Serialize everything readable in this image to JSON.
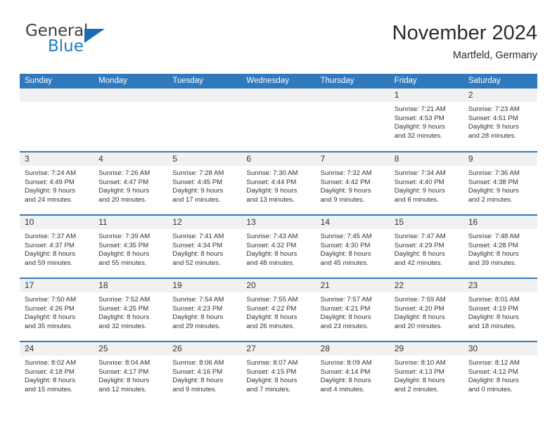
{
  "brand": {
    "name_part1": "General",
    "name_part2": "Blue"
  },
  "header": {
    "title": "November 2024",
    "subtitle": "Martfeld, Germany"
  },
  "weekday_headers": [
    "Sunday",
    "Monday",
    "Tuesday",
    "Wednesday",
    "Thursday",
    "Friday",
    "Saturday"
  ],
  "colors": {
    "header_blue": "#3079bd",
    "daynum_band": "#f1f1f1",
    "brand_blue": "#1d7cc4",
    "text": "#333333"
  },
  "weeks": [
    [
      {
        "day": "",
        "lines": []
      },
      {
        "day": "",
        "lines": []
      },
      {
        "day": "",
        "lines": []
      },
      {
        "day": "",
        "lines": []
      },
      {
        "day": "",
        "lines": []
      },
      {
        "day": "1",
        "lines": [
          "Sunrise: 7:21 AM",
          "Sunset: 4:53 PM",
          "Daylight: 9 hours",
          "and 32 minutes."
        ]
      },
      {
        "day": "2",
        "lines": [
          "Sunrise: 7:23 AM",
          "Sunset: 4:51 PM",
          "Daylight: 9 hours",
          "and 28 minutes."
        ]
      }
    ],
    [
      {
        "day": "3",
        "lines": [
          "Sunrise: 7:24 AM",
          "Sunset: 4:49 PM",
          "Daylight: 9 hours",
          "and 24 minutes."
        ]
      },
      {
        "day": "4",
        "lines": [
          "Sunrise: 7:26 AM",
          "Sunset: 4:47 PM",
          "Daylight: 9 hours",
          "and 20 minutes."
        ]
      },
      {
        "day": "5",
        "lines": [
          "Sunrise: 7:28 AM",
          "Sunset: 4:45 PM",
          "Daylight: 9 hours",
          "and 17 minutes."
        ]
      },
      {
        "day": "6",
        "lines": [
          "Sunrise: 7:30 AM",
          "Sunset: 4:44 PM",
          "Daylight: 9 hours",
          "and 13 minutes."
        ]
      },
      {
        "day": "7",
        "lines": [
          "Sunrise: 7:32 AM",
          "Sunset: 4:42 PM",
          "Daylight: 9 hours",
          "and 9 minutes."
        ]
      },
      {
        "day": "8",
        "lines": [
          "Sunrise: 7:34 AM",
          "Sunset: 4:40 PM",
          "Daylight: 9 hours",
          "and 6 minutes."
        ]
      },
      {
        "day": "9",
        "lines": [
          "Sunrise: 7:36 AM",
          "Sunset: 4:38 PM",
          "Daylight: 9 hours",
          "and 2 minutes."
        ]
      }
    ],
    [
      {
        "day": "10",
        "lines": [
          "Sunrise: 7:37 AM",
          "Sunset: 4:37 PM",
          "Daylight: 8 hours",
          "and 59 minutes."
        ]
      },
      {
        "day": "11",
        "lines": [
          "Sunrise: 7:39 AM",
          "Sunset: 4:35 PM",
          "Daylight: 8 hours",
          "and 55 minutes."
        ]
      },
      {
        "day": "12",
        "lines": [
          "Sunrise: 7:41 AM",
          "Sunset: 4:34 PM",
          "Daylight: 8 hours",
          "and 52 minutes."
        ]
      },
      {
        "day": "13",
        "lines": [
          "Sunrise: 7:43 AM",
          "Sunset: 4:32 PM",
          "Daylight: 8 hours",
          "and 48 minutes."
        ]
      },
      {
        "day": "14",
        "lines": [
          "Sunrise: 7:45 AM",
          "Sunset: 4:30 PM",
          "Daylight: 8 hours",
          "and 45 minutes."
        ]
      },
      {
        "day": "15",
        "lines": [
          "Sunrise: 7:47 AM",
          "Sunset: 4:29 PM",
          "Daylight: 8 hours",
          "and 42 minutes."
        ]
      },
      {
        "day": "16",
        "lines": [
          "Sunrise: 7:48 AM",
          "Sunset: 4:28 PM",
          "Daylight: 8 hours",
          "and 39 minutes."
        ]
      }
    ],
    [
      {
        "day": "17",
        "lines": [
          "Sunrise: 7:50 AM",
          "Sunset: 4:26 PM",
          "Daylight: 8 hours",
          "and 35 minutes."
        ]
      },
      {
        "day": "18",
        "lines": [
          "Sunrise: 7:52 AM",
          "Sunset: 4:25 PM",
          "Daylight: 8 hours",
          "and 32 minutes."
        ]
      },
      {
        "day": "19",
        "lines": [
          "Sunrise: 7:54 AM",
          "Sunset: 4:23 PM",
          "Daylight: 8 hours",
          "and 29 minutes."
        ]
      },
      {
        "day": "20",
        "lines": [
          "Sunrise: 7:55 AM",
          "Sunset: 4:22 PM",
          "Daylight: 8 hours",
          "and 26 minutes."
        ]
      },
      {
        "day": "21",
        "lines": [
          "Sunrise: 7:57 AM",
          "Sunset: 4:21 PM",
          "Daylight: 8 hours",
          "and 23 minutes."
        ]
      },
      {
        "day": "22",
        "lines": [
          "Sunrise: 7:59 AM",
          "Sunset: 4:20 PM",
          "Daylight: 8 hours",
          "and 20 minutes."
        ]
      },
      {
        "day": "23",
        "lines": [
          "Sunrise: 8:01 AM",
          "Sunset: 4:19 PM",
          "Daylight: 8 hours",
          "and 18 minutes."
        ]
      }
    ],
    [
      {
        "day": "24",
        "lines": [
          "Sunrise: 8:02 AM",
          "Sunset: 4:18 PM",
          "Daylight: 8 hours",
          "and 15 minutes."
        ]
      },
      {
        "day": "25",
        "lines": [
          "Sunrise: 8:04 AM",
          "Sunset: 4:17 PM",
          "Daylight: 8 hours",
          "and 12 minutes."
        ]
      },
      {
        "day": "26",
        "lines": [
          "Sunrise: 8:06 AM",
          "Sunset: 4:16 PM",
          "Daylight: 8 hours",
          "and 9 minutes."
        ]
      },
      {
        "day": "27",
        "lines": [
          "Sunrise: 8:07 AM",
          "Sunset: 4:15 PM",
          "Daylight: 8 hours",
          "and 7 minutes."
        ]
      },
      {
        "day": "28",
        "lines": [
          "Sunrise: 8:09 AM",
          "Sunset: 4:14 PM",
          "Daylight: 8 hours",
          "and 4 minutes."
        ]
      },
      {
        "day": "29",
        "lines": [
          "Sunrise: 8:10 AM",
          "Sunset: 4:13 PM",
          "Daylight: 8 hours",
          "and 2 minutes."
        ]
      },
      {
        "day": "30",
        "lines": [
          "Sunrise: 8:12 AM",
          "Sunset: 4:12 PM",
          "Daylight: 8 hours",
          "and 0 minutes."
        ]
      }
    ]
  ]
}
